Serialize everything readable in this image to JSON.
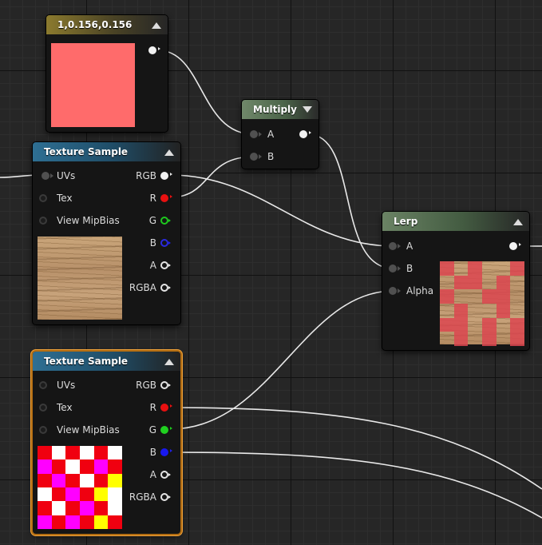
{
  "colors": {
    "wire": "#e8e8e8",
    "const_swatch": "#ff6b6b",
    "pin_red": "#e81010",
    "pin_green": "#1ec81e",
    "pin_blue": "#1818ee",
    "selection": "#f0a23a"
  },
  "nodes": {
    "constant": {
      "title": "1,0.156,0.156"
    },
    "multiply": {
      "title": "Multiply",
      "inputs": [
        "A",
        "B"
      ]
    },
    "texture_sample_1": {
      "title": "Texture Sample",
      "inputs": [
        "UVs",
        "Tex",
        "View MipBias"
      ],
      "outputs": [
        "RGB",
        "R",
        "G",
        "B",
        "A",
        "RGBA"
      ]
    },
    "lerp": {
      "title": "Lerp",
      "inputs": [
        "A",
        "B",
        "Alpha"
      ]
    },
    "texture_sample_2": {
      "title": "Texture Sample",
      "inputs": [
        "UVs",
        "Tex",
        "View MipBias"
      ],
      "outputs": [
        "RGB",
        "R",
        "G",
        "B",
        "A",
        "RGBA"
      ]
    }
  },
  "icons": {
    "collapse": "triangle-up-icon",
    "expand": "triangle-down-icon"
  }
}
